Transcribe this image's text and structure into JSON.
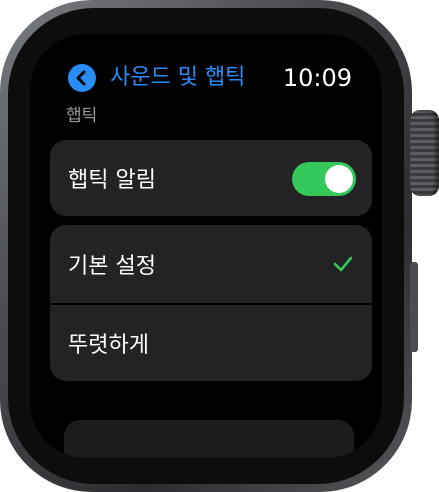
{
  "header": {
    "title": "사운드 및 햅틱",
    "time": "10:09"
  },
  "section": {
    "label": "햅틱"
  },
  "rows": {
    "haptic_alerts": {
      "label": "햅틱 알림",
      "toggle_on": true
    },
    "default": {
      "label": "기본 설정",
      "selected": true
    },
    "prominent": {
      "label": "뚜렷하게",
      "selected": false
    }
  },
  "colors": {
    "accent_blue": "#2a8cf7",
    "toggle_green": "#34c759",
    "check_green": "#34c759",
    "row_background": "#232325",
    "section_label": "#9a9a9f"
  },
  "icons": {
    "back": "chevron-left-icon",
    "selected": "checkmark-icon"
  }
}
